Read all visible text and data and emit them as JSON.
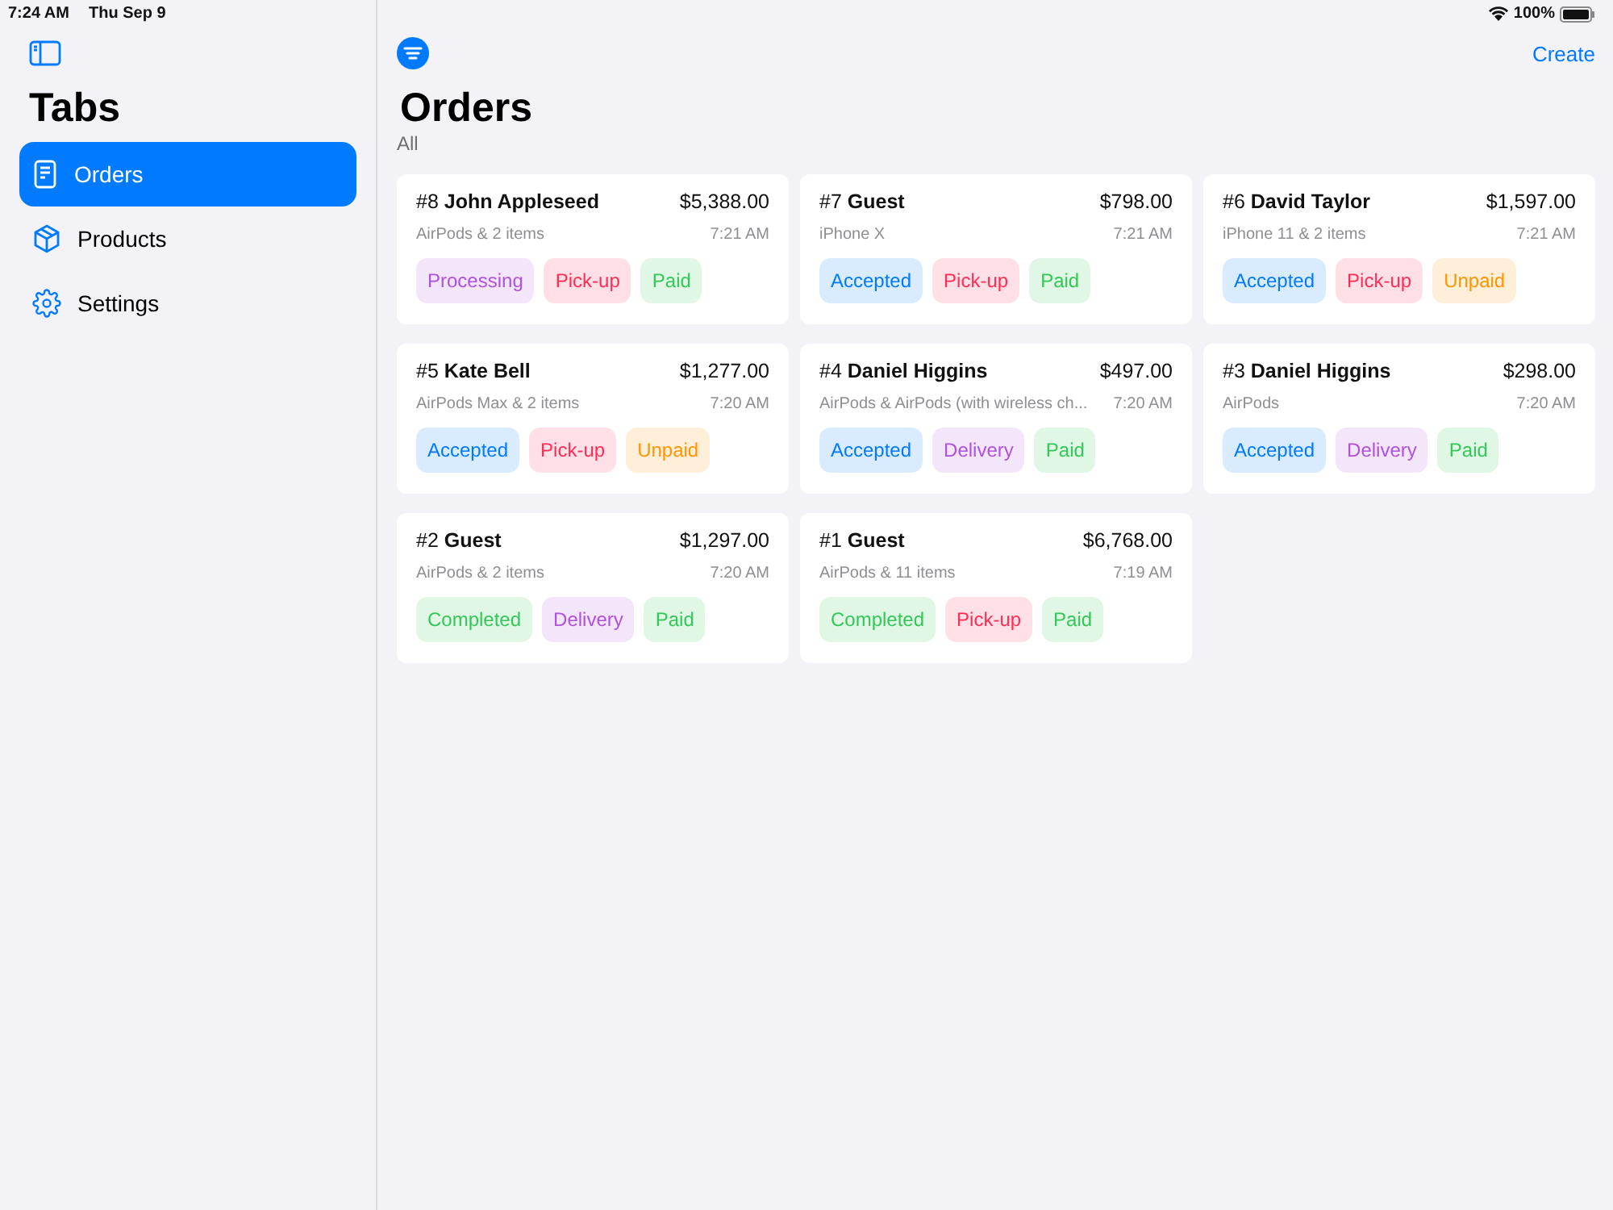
{
  "status_bar": {
    "time": "7:24 AM",
    "date": "Thu Sep 9",
    "battery": "100%"
  },
  "sidebar": {
    "title": "Tabs",
    "items": [
      {
        "label": "Orders",
        "selected": true
      },
      {
        "label": "Products",
        "selected": false
      },
      {
        "label": "Settings",
        "selected": false
      }
    ]
  },
  "toolbar": {
    "create": "Create"
  },
  "page": {
    "title": "Orders",
    "filter": "All"
  },
  "orders": [
    {
      "number": "#8",
      "customer": "John Appleseed",
      "total": "$5,388.00",
      "items": "AirPods & 2 items",
      "time": "7:21 AM",
      "tags": [
        {
          "label": "Processing",
          "color": "#af52de"
        },
        {
          "label": "Pick-up",
          "color": "#ff2d55"
        },
        {
          "label": "Paid",
          "color": "#34c759"
        }
      ]
    },
    {
      "number": "#7",
      "customer": "Guest",
      "total": "$798.00",
      "items": "iPhone X",
      "time": "7:21 AM",
      "tags": [
        {
          "label": "Accepted",
          "color": "#007aff"
        },
        {
          "label": "Pick-up",
          "color": "#ff2d55"
        },
        {
          "label": "Paid",
          "color": "#34c759"
        }
      ]
    },
    {
      "number": "#6",
      "customer": "David Taylor",
      "total": "$1,597.00",
      "items": "iPhone 11 & 2 items",
      "time": "7:21 AM",
      "tags": [
        {
          "label": "Accepted",
          "color": "#007aff"
        },
        {
          "label": "Pick-up",
          "color": "#ff2d55"
        },
        {
          "label": "Unpaid",
          "color": "#ff9500"
        }
      ]
    },
    {
      "number": "#5",
      "customer": "Kate Bell",
      "total": "$1,277.00",
      "items": "AirPods Max & 2 items",
      "time": "7:20 AM",
      "tags": [
        {
          "label": "Accepted",
          "color": "#007aff"
        },
        {
          "label": "Pick-up",
          "color": "#ff2d55"
        },
        {
          "label": "Unpaid",
          "color": "#ff9500"
        }
      ]
    },
    {
      "number": "#4",
      "customer": "Daniel Higgins",
      "total": "$497.00",
      "items": "AirPods & AirPods (with wireless ch...",
      "time": "7:20 AM",
      "tags": [
        {
          "label": "Accepted",
          "color": "#007aff"
        },
        {
          "label": "Delivery",
          "color": "#af52de"
        },
        {
          "label": "Paid",
          "color": "#34c759"
        }
      ]
    },
    {
      "number": "#3",
      "customer": "Daniel Higgins",
      "total": "$298.00",
      "items": "AirPods",
      "time": "7:20 AM",
      "tags": [
        {
          "label": "Accepted",
          "color": "#007aff"
        },
        {
          "label": "Delivery",
          "color": "#af52de"
        },
        {
          "label": "Paid",
          "color": "#34c759"
        }
      ]
    },
    {
      "number": "#2",
      "customer": "Guest",
      "total": "$1,297.00",
      "items": "AirPods & 2 items",
      "time": "7:20 AM",
      "tags": [
        {
          "label": "Completed",
          "color": "#34c759"
        },
        {
          "label": "Delivery",
          "color": "#af52de"
        },
        {
          "label": "Paid",
          "color": "#34c759"
        }
      ]
    },
    {
      "number": "#1",
      "customer": "Guest",
      "total": "$6,768.00",
      "items": "AirPods & 11 items",
      "time": "7:19 AM",
      "tags": [
        {
          "label": "Completed",
          "color": "#34c759"
        },
        {
          "label": "Pick-up",
          "color": "#ff2d55"
        },
        {
          "label": "Paid",
          "color": "#34c759"
        }
      ]
    }
  ]
}
